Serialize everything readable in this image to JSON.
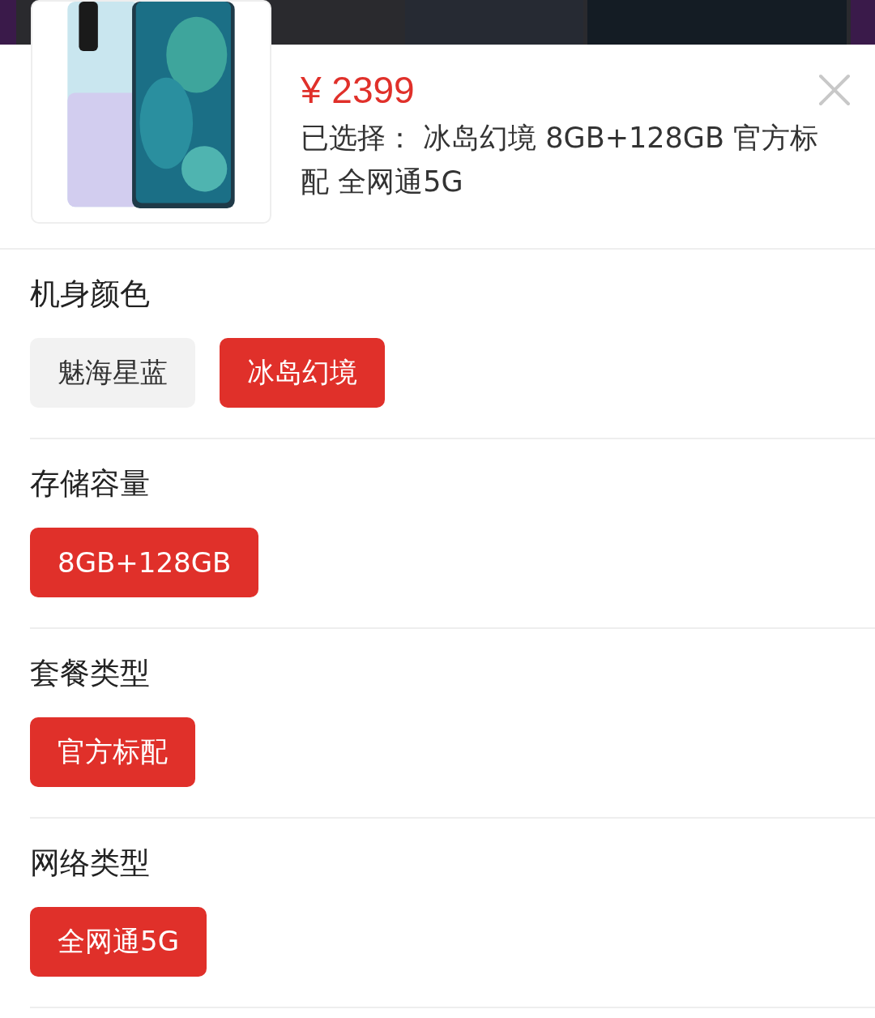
{
  "product": {
    "kind": "picture",
    "price": "¥ 2399",
    "selected_label": "已选择：",
    "selected_text": "冰岛幻境 8GB+128GB 官方标配 全网通5G"
  },
  "option_groups": [
    {
      "title": "机身颜色",
      "options": [
        {
          "label": "魅海星蓝",
          "selected": false
        },
        {
          "label": "冰岛幻境",
          "selected": true
        }
      ]
    },
    {
      "title": "存储容量",
      "options": [
        {
          "label": "8GB+128GB",
          "selected": true
        }
      ]
    },
    {
      "title": "套餐类型",
      "options": [
        {
          "label": "官方标配",
          "selected": true
        }
      ]
    },
    {
      "title": "网络类型",
      "options": [
        {
          "label": "全网通5G",
          "selected": true
        }
      ]
    }
  ]
}
